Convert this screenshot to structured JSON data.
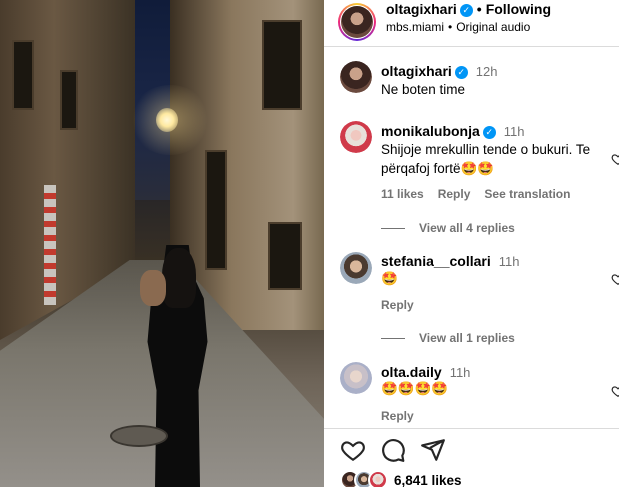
{
  "post": {
    "author": "oltagixhari",
    "follow_status": "Following",
    "subtitle_location": "mbs.miami",
    "subtitle_audio": "Original audio"
  },
  "comments": [
    {
      "username": "oltagixhari",
      "verified": true,
      "time": "12h",
      "text": "Ne boten time"
    },
    {
      "username": "monikalubonja",
      "verified": true,
      "time": "11h",
      "text": "Shijoje mrekullin tende o bukuri. Te përqafoj fortë🤩🤩",
      "likes": "11 likes",
      "reply": "Reply",
      "translate": "See translation",
      "view_replies": "View all 4 replies"
    },
    {
      "username": "stefania__collari",
      "verified": false,
      "time": "11h",
      "text": "🤩",
      "reply": "Reply",
      "view_replies": "View all 1 replies"
    },
    {
      "username": "olta.daily",
      "verified": false,
      "time": "11h",
      "text": "🤩🤩🤩🤩",
      "reply": "Reply"
    }
  ],
  "footer": {
    "likes_count": "6,841 likes"
  },
  "icons": {
    "like": "heart-icon",
    "comment": "comment-icon",
    "share": "share-icon",
    "verified": "verified-badge-icon"
  },
  "colors": {
    "verified_blue": "#0095f6",
    "muted_text": "#737373",
    "divider": "#dbdbdb"
  }
}
